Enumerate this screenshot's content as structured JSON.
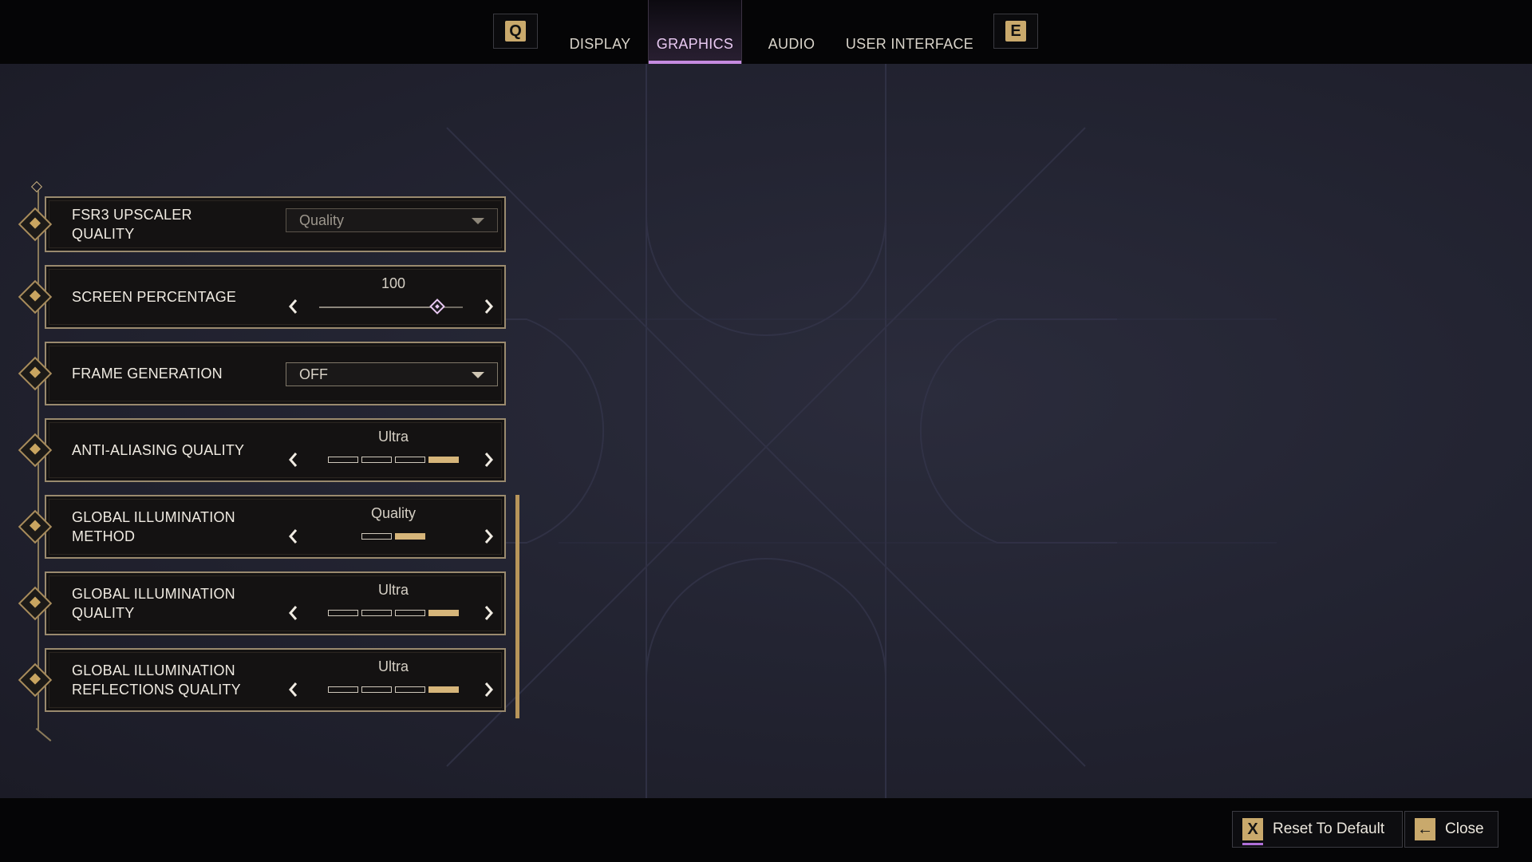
{
  "tabs": [
    {
      "label": "DISPLAY",
      "active": false
    },
    {
      "label": "GRAPHICS",
      "active": true
    },
    {
      "label": "AUDIO",
      "active": false
    },
    {
      "label": "USER INTERFACE",
      "active": false
    }
  ],
  "tab_keys": {
    "prev": "Q",
    "next": "E"
  },
  "settings": {
    "fsr3": {
      "label": "FSR3 UPSCALER QUALITY",
      "value": "Quality",
      "enabled": false
    },
    "screen_pct": {
      "label": "SCREEN PERCENTAGE",
      "value": "100",
      "slider_fraction": 0.82
    },
    "frame_gen": {
      "label": "FRAME GENERATION",
      "value": "OFF"
    },
    "aa": {
      "label": "ANTI-ALIASING QUALITY",
      "value": "Ultra",
      "level": 4,
      "levels": 4
    },
    "gi_method": {
      "label_line1": "GLOBAL ILLUMINATION",
      "label_line2": "METHOD",
      "value": "Quality",
      "level": 2,
      "levels": 2
    },
    "gi_quality": {
      "label_line1": "GLOBAL ILLUMINATION",
      "label_line2": "QUALITY",
      "value": "Ultra",
      "level": 4,
      "levels": 4
    },
    "gi_reflections": {
      "label_line1": "GLOBAL ILLUMINATION",
      "label_line2": "REFLECTIONS QUALITY",
      "value": "Ultra",
      "level": 4,
      "levels": 4
    }
  },
  "footer": {
    "reset": {
      "key": "X",
      "label": "Reset To Default"
    },
    "close": {
      "key": "←",
      "label": "Close"
    }
  },
  "colors": {
    "accent": "#c58be0",
    "gold": "#d6b57a",
    "border": "#9a8a6e"
  }
}
